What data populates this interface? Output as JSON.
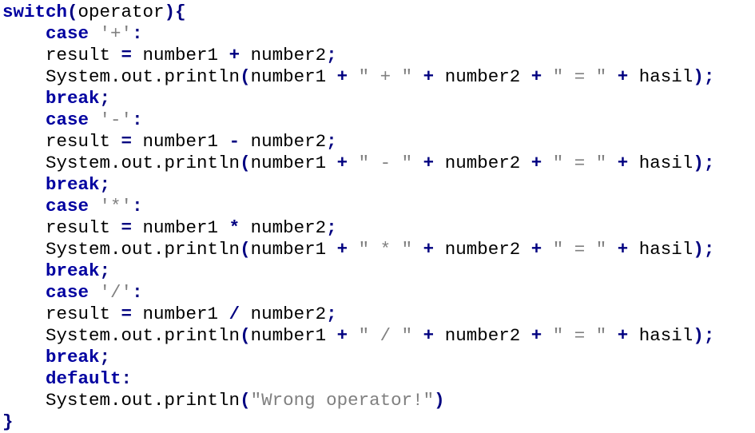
{
  "code_lines": [
    [
      {
        "t": "kw",
        "v": "switch"
      },
      {
        "t": "op",
        "v": "("
      },
      {
        "t": "plain",
        "v": "operator"
      },
      {
        "t": "op",
        "v": "){"
      }
    ],
    [
      {
        "t": "plain",
        "v": "    "
      },
      {
        "t": "kw",
        "v": "case"
      },
      {
        "t": "plain",
        "v": " "
      },
      {
        "t": "str",
        "v": "'+'"
      },
      {
        "t": "op",
        "v": ":"
      }
    ],
    [
      {
        "t": "plain",
        "v": "    result "
      },
      {
        "t": "op",
        "v": "="
      },
      {
        "t": "plain",
        "v": " number1 "
      },
      {
        "t": "op",
        "v": "+"
      },
      {
        "t": "plain",
        "v": " number2"
      },
      {
        "t": "op",
        "v": ";"
      }
    ],
    [
      {
        "t": "plain",
        "v": "    System.out.println"
      },
      {
        "t": "op",
        "v": "("
      },
      {
        "t": "plain",
        "v": "number1 "
      },
      {
        "t": "op",
        "v": "+"
      },
      {
        "t": "plain",
        "v": " "
      },
      {
        "t": "str",
        "v": "\" + \""
      },
      {
        "t": "plain",
        "v": " "
      },
      {
        "t": "op",
        "v": "+"
      },
      {
        "t": "plain",
        "v": " number2 "
      },
      {
        "t": "op",
        "v": "+"
      },
      {
        "t": "plain",
        "v": " "
      },
      {
        "t": "str",
        "v": "\" = \""
      },
      {
        "t": "plain",
        "v": " "
      },
      {
        "t": "op",
        "v": "+"
      },
      {
        "t": "plain",
        "v": " hasil"
      },
      {
        "t": "op",
        "v": ");"
      }
    ],
    [
      {
        "t": "plain",
        "v": "    "
      },
      {
        "t": "kw",
        "v": "break"
      },
      {
        "t": "op",
        "v": ";"
      }
    ],
    [
      {
        "t": "plain",
        "v": "    "
      },
      {
        "t": "kw",
        "v": "case"
      },
      {
        "t": "plain",
        "v": " "
      },
      {
        "t": "str",
        "v": "'-'"
      },
      {
        "t": "op",
        "v": ":"
      }
    ],
    [
      {
        "t": "plain",
        "v": "    result "
      },
      {
        "t": "op",
        "v": "="
      },
      {
        "t": "plain",
        "v": " number1 "
      },
      {
        "t": "op",
        "v": "-"
      },
      {
        "t": "plain",
        "v": " number2"
      },
      {
        "t": "op",
        "v": ";"
      }
    ],
    [
      {
        "t": "plain",
        "v": "    System.out.println"
      },
      {
        "t": "op",
        "v": "("
      },
      {
        "t": "plain",
        "v": "number1 "
      },
      {
        "t": "op",
        "v": "+"
      },
      {
        "t": "plain",
        "v": " "
      },
      {
        "t": "str",
        "v": "\" - \""
      },
      {
        "t": "plain",
        "v": " "
      },
      {
        "t": "op",
        "v": "+"
      },
      {
        "t": "plain",
        "v": " number2 "
      },
      {
        "t": "op",
        "v": "+"
      },
      {
        "t": "plain",
        "v": " "
      },
      {
        "t": "str",
        "v": "\" = \""
      },
      {
        "t": "plain",
        "v": " "
      },
      {
        "t": "op",
        "v": "+"
      },
      {
        "t": "plain",
        "v": " hasil"
      },
      {
        "t": "op",
        "v": ");"
      }
    ],
    [
      {
        "t": "plain",
        "v": "    "
      },
      {
        "t": "kw",
        "v": "break"
      },
      {
        "t": "op",
        "v": ";"
      }
    ],
    [
      {
        "t": "plain",
        "v": "    "
      },
      {
        "t": "kw",
        "v": "case"
      },
      {
        "t": "plain",
        "v": " "
      },
      {
        "t": "str",
        "v": "'*'"
      },
      {
        "t": "op",
        "v": ":"
      }
    ],
    [
      {
        "t": "plain",
        "v": "    result "
      },
      {
        "t": "op",
        "v": "="
      },
      {
        "t": "plain",
        "v": " number1 "
      },
      {
        "t": "op",
        "v": "*"
      },
      {
        "t": "plain",
        "v": " number2"
      },
      {
        "t": "op",
        "v": ";"
      }
    ],
    [
      {
        "t": "plain",
        "v": "    System.out.println"
      },
      {
        "t": "op",
        "v": "("
      },
      {
        "t": "plain",
        "v": "number1 "
      },
      {
        "t": "op",
        "v": "+"
      },
      {
        "t": "plain",
        "v": " "
      },
      {
        "t": "str",
        "v": "\" * \""
      },
      {
        "t": "plain",
        "v": " "
      },
      {
        "t": "op",
        "v": "+"
      },
      {
        "t": "plain",
        "v": " number2 "
      },
      {
        "t": "op",
        "v": "+"
      },
      {
        "t": "plain",
        "v": " "
      },
      {
        "t": "str",
        "v": "\" = \""
      },
      {
        "t": "plain",
        "v": " "
      },
      {
        "t": "op",
        "v": "+"
      },
      {
        "t": "plain",
        "v": " hasil"
      },
      {
        "t": "op",
        "v": ");"
      }
    ],
    [
      {
        "t": "plain",
        "v": "    "
      },
      {
        "t": "kw",
        "v": "break"
      },
      {
        "t": "op",
        "v": ";"
      }
    ],
    [
      {
        "t": "plain",
        "v": "    "
      },
      {
        "t": "kw",
        "v": "case"
      },
      {
        "t": "plain",
        "v": " "
      },
      {
        "t": "str",
        "v": "'/'"
      },
      {
        "t": "op",
        "v": ":"
      }
    ],
    [
      {
        "t": "plain",
        "v": "    result "
      },
      {
        "t": "op",
        "v": "="
      },
      {
        "t": "plain",
        "v": " number1 "
      },
      {
        "t": "op",
        "v": "/"
      },
      {
        "t": "plain",
        "v": " number2"
      },
      {
        "t": "op",
        "v": ";"
      }
    ],
    [
      {
        "t": "plain",
        "v": "    System.out.println"
      },
      {
        "t": "op",
        "v": "("
      },
      {
        "t": "plain",
        "v": "number1 "
      },
      {
        "t": "op",
        "v": "+"
      },
      {
        "t": "plain",
        "v": " "
      },
      {
        "t": "str",
        "v": "\" / \""
      },
      {
        "t": "plain",
        "v": " "
      },
      {
        "t": "op",
        "v": "+"
      },
      {
        "t": "plain",
        "v": " number2 "
      },
      {
        "t": "op",
        "v": "+"
      },
      {
        "t": "plain",
        "v": " "
      },
      {
        "t": "str",
        "v": "\" = \""
      },
      {
        "t": "plain",
        "v": " "
      },
      {
        "t": "op",
        "v": "+"
      },
      {
        "t": "plain",
        "v": " hasil"
      },
      {
        "t": "op",
        "v": ");"
      }
    ],
    [
      {
        "t": "plain",
        "v": "    "
      },
      {
        "t": "kw",
        "v": "break"
      },
      {
        "t": "op",
        "v": ";"
      }
    ],
    [
      {
        "t": "plain",
        "v": "    "
      },
      {
        "t": "kw",
        "v": "default"
      },
      {
        "t": "op",
        "v": ":"
      }
    ],
    [
      {
        "t": "plain",
        "v": "    System.out.println"
      },
      {
        "t": "op",
        "v": "("
      },
      {
        "t": "str",
        "v": "\"Wrong operator!\""
      },
      {
        "t": "op",
        "v": ")"
      }
    ],
    [
      {
        "t": "op",
        "v": "}"
      }
    ]
  ],
  "colors": {
    "keyword": "#0000a0",
    "operator": "#000080",
    "string": "#808080",
    "plain": "#000000",
    "background": "#ffffff"
  }
}
